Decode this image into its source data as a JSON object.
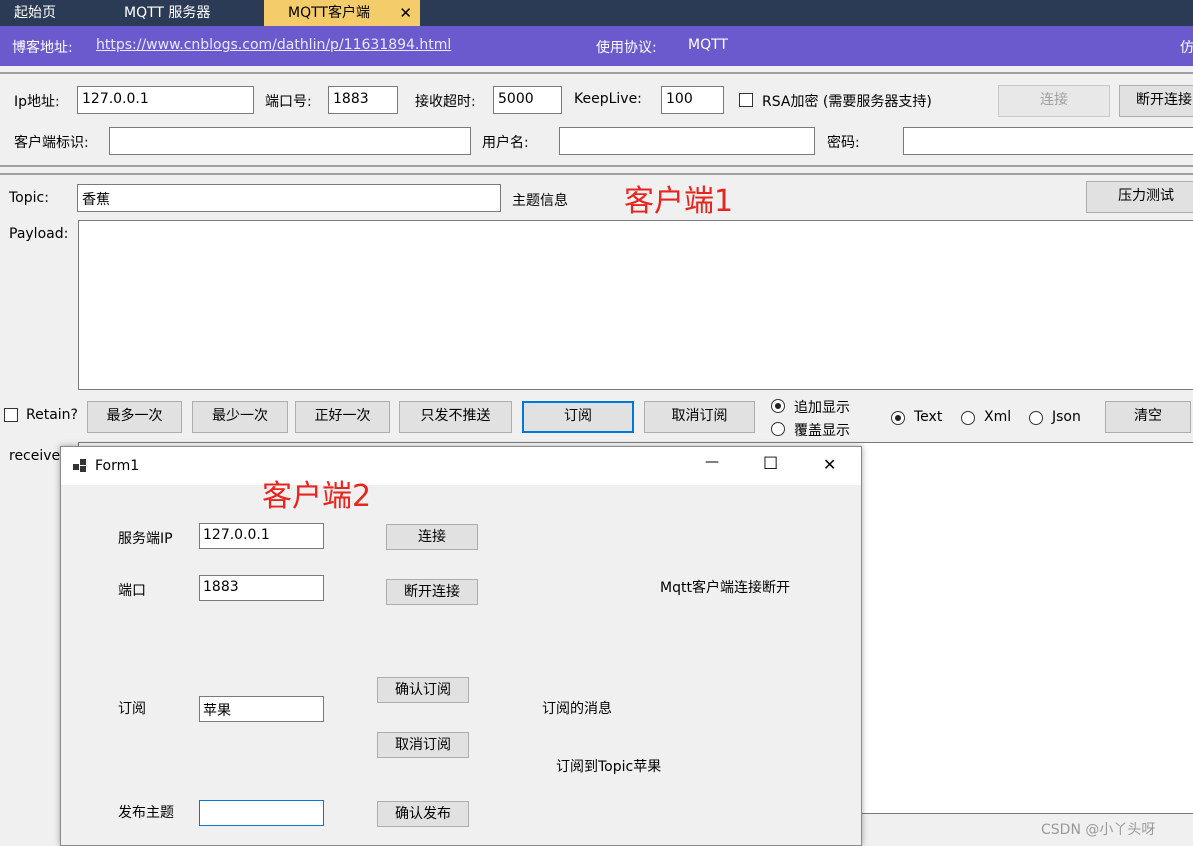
{
  "tabs": [
    {
      "label": "起始页"
    },
    {
      "label": "MQTT 服务器"
    },
    {
      "label": "MQTT客户端",
      "close": "✕"
    }
  ],
  "bluebar": {
    "blog_label": "博客地址:",
    "blog_url": "https://www.cnblogs.com/dathlin/p/11631894.html",
    "protocol_label": "使用协议:",
    "protocol_value": "MQTT",
    "right_text": "仿"
  },
  "conn": {
    "ip_label": "Ip地址:",
    "ip_value": "127.0.0.1",
    "port_label": "端口号:",
    "port_value": "1883",
    "timeout_label": "接收超时:",
    "timeout_value": "5000",
    "keeplive_label": "KeepLive:",
    "keeplive_value": "100",
    "rsa_label": "RSA加密 (需要服务器支持)",
    "connect_btn": "连接",
    "disconnect_btn": "断开连接",
    "clientid_label": "客户端标识:",
    "clientid_value": "",
    "username_label": "用户名:",
    "username_value": "",
    "password_label": "密码:",
    "password_value": ""
  },
  "topic": {
    "topic_label": "Topic:",
    "topic_value": "香蕉",
    "topic_info": "主题信息",
    "annotation": "客户端1",
    "stress_btn": "压力测试",
    "payload_label": "Payload:"
  },
  "actions": {
    "retain_label": "Retain?",
    "at_most_once": "最多一次",
    "at_least_once": "最少一次",
    "exactly_once": "正好一次",
    "publish_only": "只发不推送",
    "subscribe": "订阅",
    "unsubscribe": "取消订阅",
    "append_display": "追加显示",
    "overwrite_display": "覆盖显示",
    "fmt_text": "Text",
    "fmt_xml": "Xml",
    "fmt_json": "Json",
    "clear": "清空",
    "receive_label": "receive"
  },
  "form1": {
    "title": "Form1",
    "annotation": "客户端2",
    "server_ip_label": "服务端IP",
    "server_ip_value": "127.0.0.1",
    "connect_btn": "连接",
    "port_label": "端口",
    "port_value": "1883",
    "disconnect_btn": "断开连接",
    "status_text": "Mqtt客户端连接断开",
    "subscribe_label": "订阅",
    "subscribe_value": "苹果",
    "confirm_subscribe_btn": "确认订阅",
    "message_label": "订阅的消息",
    "unsubscribe_btn": "取消订阅",
    "subscribed_text": "订阅到Topic苹果",
    "publish_label": "发布主题",
    "publish_value": "",
    "confirm_publish_btn": "确认发布",
    "minimize": "—",
    "maximize": "☐",
    "close": "✕"
  },
  "watermark": "CSDN @小丫头呀",
  "colors": {
    "tabbar": "#2b3a55",
    "active_tab": "#f5cc6a",
    "infobar": "#6a5acd",
    "annotation": "#e8241e",
    "focus": "#0078d7"
  }
}
